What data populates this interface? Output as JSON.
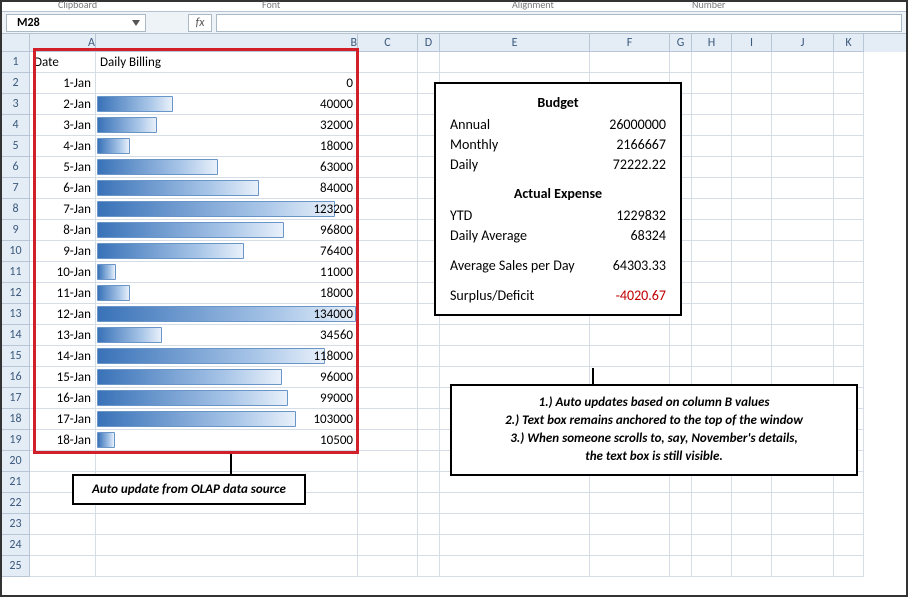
{
  "ribbon": {
    "clipboard": "Clipboard",
    "font": "Font",
    "alignment": "Alignment",
    "number": "Number"
  },
  "name_box": "M28",
  "fx_label": "fx",
  "columns": [
    "A",
    "B",
    "C",
    "D",
    "E",
    "F",
    "G",
    "H",
    "I",
    "J",
    "K"
  ],
  "headers": {
    "date": "Date",
    "billing": "Daily Billing"
  },
  "chart_data": {
    "type": "bar",
    "orientation": "horizontal",
    "title": "Daily Billing",
    "xlabel": "",
    "ylabel": "Date",
    "categories": [
      "1-Jan",
      "2-Jan",
      "3-Jan",
      "4-Jan",
      "5-Jan",
      "6-Jan",
      "7-Jan",
      "8-Jan",
      "9-Jan",
      "10-Jan",
      "11-Jan",
      "12-Jan",
      "13-Jan",
      "14-Jan",
      "15-Jan",
      "16-Jan",
      "17-Jan",
      "18-Jan"
    ],
    "values": [
      0,
      40000,
      32000,
      18000,
      63000,
      84000,
      123200,
      96800,
      76400,
      11000,
      18000,
      134000,
      34560,
      118000,
      96000,
      99000,
      103000,
      10500
    ],
    "max": 134000
  },
  "budget": {
    "title": "Budget",
    "annual_label": "Annual",
    "annual": "26000000",
    "monthly_label": "Monthly",
    "monthly": "2166667",
    "daily_label": "Daily",
    "daily": "72222.22",
    "actual_title": "Actual Expense",
    "ytd_label": "YTD",
    "ytd": "1229832",
    "avg_label": "Daily Average",
    "avg": "68324",
    "sales_label": "Average Sales per Day",
    "sales": "64303.33",
    "surplus_label": "Surplus/Deficit",
    "surplus": "-4020.67"
  },
  "callout_olap": "Auto update from OLAP data source",
  "notes": {
    "l1": "1.) Auto updates based on column B values",
    "l2": "2.) Text box remains anchored to the top of the window",
    "l3": "3.) When someone scrolls to, say, November's details,",
    "l4": "the text box is still visible."
  }
}
